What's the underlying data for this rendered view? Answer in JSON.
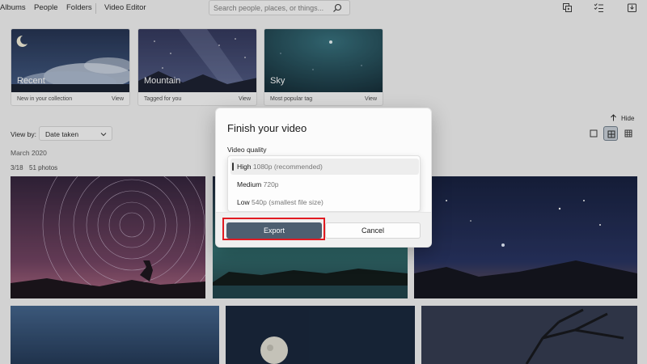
{
  "nav": {
    "items": [
      "Albums",
      "People",
      "Folders",
      "Video Editor"
    ]
  },
  "search": {
    "placeholder": "Search people, places, or things..."
  },
  "top_icons": [
    "slideshow-icon",
    "select-checklist-icon",
    "import-icon"
  ],
  "collections": [
    {
      "title": "Recent",
      "subtitle": "New in your collection",
      "view": "View"
    },
    {
      "title": "Mountain",
      "subtitle": "Tagged for you",
      "view": "View"
    },
    {
      "title": "Sky",
      "subtitle": "Most popular tag",
      "view": "View"
    }
  ],
  "hide_label": "Hide",
  "view_by": {
    "label": "View by:",
    "value": "Date taken"
  },
  "view_toggles": [
    "view-small-icon",
    "view-medium-icon",
    "view-large-icon"
  ],
  "group": {
    "month": "March 2020",
    "date": "3/18",
    "count": "51 photos"
  },
  "dialog": {
    "title": "Finish your video",
    "quality_label": "Video quality",
    "options": [
      {
        "name": "High",
        "detail": "1080p (recommended)",
        "selected": true
      },
      {
        "name": "Medium",
        "detail": "720p",
        "selected": false
      },
      {
        "name": "Low",
        "detail": "540p (smallest file size)",
        "selected": false
      }
    ],
    "export_label": "Export",
    "cancel_label": "Cancel"
  },
  "colors": {
    "accent_button": "#4e5f70",
    "highlight_box": "#e11b22",
    "background": "#f3f3f3"
  }
}
